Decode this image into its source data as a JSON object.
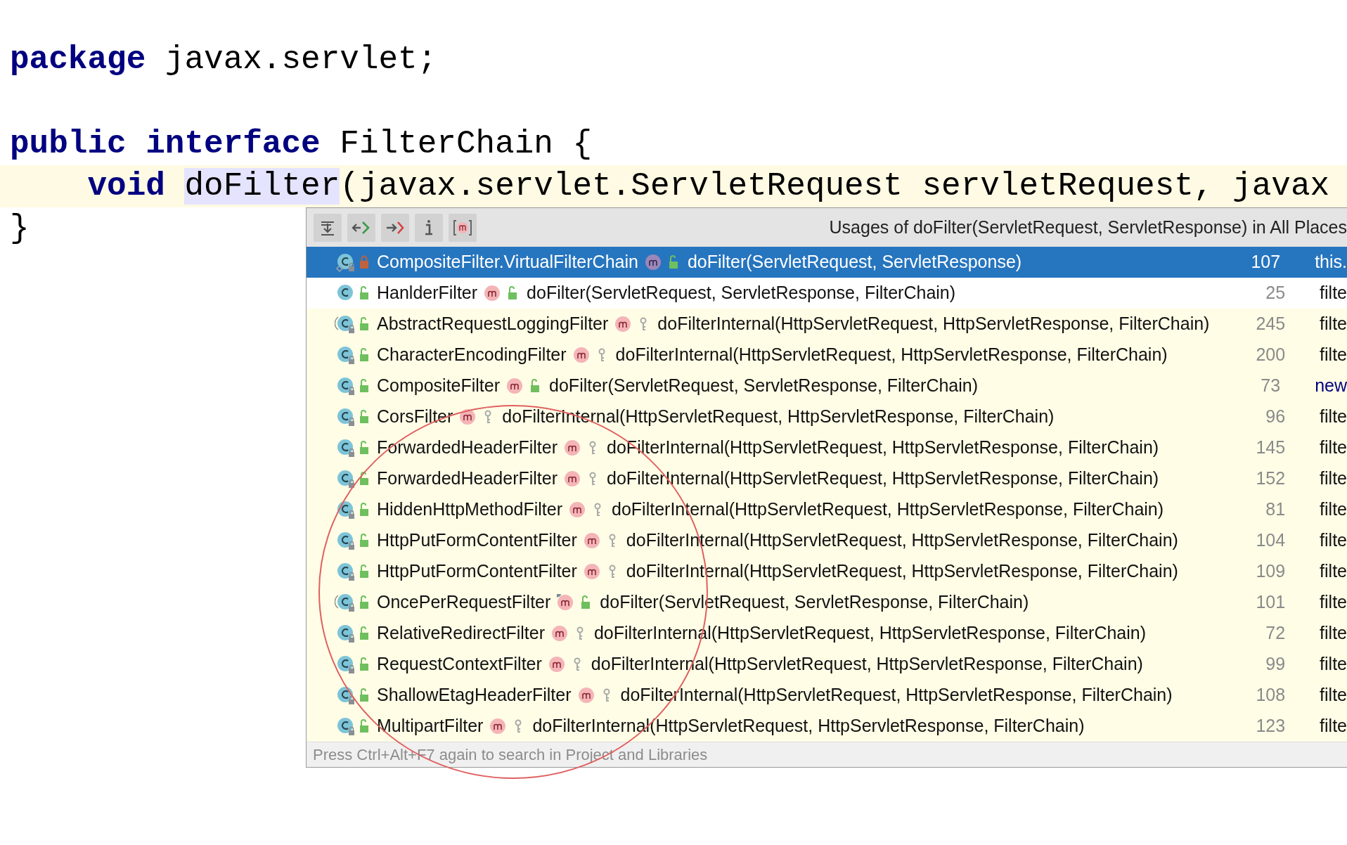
{
  "editor": {
    "blocks": [
      [
        {
          "current": false,
          "tokens": [
            {
              "kind": "keyword",
              "text": "package "
            },
            {
              "kind": "plain",
              "text": "javax.servlet;"
            }
          ]
        }
      ],
      [
        {
          "current": false,
          "tokens": [
            {
              "kind": "keyword",
              "text": "public interface "
            },
            {
              "kind": "plain",
              "text": "FilterChain {"
            }
          ]
        },
        {
          "current": true,
          "tokens": [
            {
              "kind": "keyword",
              "text": "    void "
            },
            {
              "kind": "usage",
              "text": "doFilter"
            },
            {
              "kind": "plain",
              "text": "(javax.servlet.ServletRequest servletRequest, javax"
            }
          ]
        },
        {
          "current": false,
          "tokens": [
            {
              "kind": "plain",
              "text": "}"
            }
          ]
        }
      ]
    ]
  },
  "usages_popup": {
    "toolbar": [
      {
        "kind": "merge"
      },
      {
        "kind": "previous"
      },
      {
        "kind": "next"
      },
      {
        "kind": "info"
      },
      {
        "kind": "methods"
      }
    ],
    "title": "Usages of doFilter(ServletRequest, ServletResponse) in All Places",
    "rows": [
      {
        "inner_class": true,
        "abstract": false,
        "library": true,
        "class_private": true,
        "class_name": "CompositeFilter.VirtualFilterChain",
        "overrides": false,
        "method_protected": false,
        "method": "doFilter(ServletRequest, ServletResponse)",
        "line": "107",
        "preview": "this.",
        "preview_keyword": false,
        "selected": true
      },
      {
        "inner_class": false,
        "abstract": false,
        "library": false,
        "class_private": false,
        "class_name": "HanlderFilter",
        "overrides": false,
        "method_protected": false,
        "method": "doFilter(ServletRequest, ServletResponse, FilterChain)",
        "line": "25",
        "preview": "filte",
        "preview_keyword": false,
        "selected": false
      },
      {
        "inner_class": false,
        "abstract": true,
        "library": true,
        "class_private": false,
        "class_name": "AbstractRequestLoggingFilter",
        "overrides": false,
        "method_protected": true,
        "method": "doFilterInternal(HttpServletRequest, HttpServletResponse, FilterChain)",
        "line": "245",
        "preview": "filte",
        "preview_keyword": false,
        "selected": false
      },
      {
        "inner_class": false,
        "abstract": false,
        "library": true,
        "class_private": false,
        "class_name": "CharacterEncodingFilter",
        "overrides": false,
        "method_protected": true,
        "method": "doFilterInternal(HttpServletRequest, HttpServletResponse, FilterChain)",
        "line": "200",
        "preview": "filte",
        "preview_keyword": false,
        "selected": false
      },
      {
        "inner_class": false,
        "abstract": false,
        "library": true,
        "class_private": false,
        "class_name": "CompositeFilter",
        "overrides": false,
        "method_protected": false,
        "method": "doFilter(ServletRequest, ServletResponse, FilterChain)",
        "line": "73",
        "preview": "new",
        "preview_keyword": true,
        "selected": false
      },
      {
        "inner_class": false,
        "abstract": false,
        "library": true,
        "class_private": false,
        "class_name": "CorsFilter",
        "overrides": false,
        "method_protected": true,
        "method": "doFilterInternal(HttpServletRequest, HttpServletResponse, FilterChain)",
        "line": "96",
        "preview": "filte",
        "preview_keyword": false,
        "selected": false
      },
      {
        "inner_class": false,
        "abstract": false,
        "library": true,
        "class_private": false,
        "class_name": "ForwardedHeaderFilter",
        "overrides": false,
        "method_protected": true,
        "method": "doFilterInternal(HttpServletRequest, HttpServletResponse, FilterChain)",
        "line": "145",
        "preview": "filte",
        "preview_keyword": false,
        "selected": false
      },
      {
        "inner_class": false,
        "abstract": false,
        "library": true,
        "class_private": false,
        "class_name": "ForwardedHeaderFilter",
        "overrides": false,
        "method_protected": true,
        "method": "doFilterInternal(HttpServletRequest, HttpServletResponse, FilterChain)",
        "line": "152",
        "preview": "filte",
        "preview_keyword": false,
        "selected": false
      },
      {
        "inner_class": false,
        "abstract": false,
        "library": true,
        "class_private": false,
        "class_name": "HiddenHttpMethodFilter",
        "overrides": false,
        "method_protected": true,
        "method": "doFilterInternal(HttpServletRequest, HttpServletResponse, FilterChain)",
        "line": "81",
        "preview": "filte",
        "preview_keyword": false,
        "selected": false
      },
      {
        "inner_class": false,
        "abstract": false,
        "library": true,
        "class_private": false,
        "class_name": "HttpPutFormContentFilter",
        "overrides": false,
        "method_protected": true,
        "method": "doFilterInternal(HttpServletRequest, HttpServletResponse, FilterChain)",
        "line": "104",
        "preview": "filte",
        "preview_keyword": false,
        "selected": false
      },
      {
        "inner_class": false,
        "abstract": false,
        "library": true,
        "class_private": false,
        "class_name": "HttpPutFormContentFilter",
        "overrides": false,
        "method_protected": true,
        "method": "doFilterInternal(HttpServletRequest, HttpServletResponse, FilterChain)",
        "line": "109",
        "preview": "filte",
        "preview_keyword": false,
        "selected": false
      },
      {
        "inner_class": false,
        "abstract": true,
        "library": true,
        "class_private": false,
        "class_name": "OncePerRequestFilter",
        "overrides": true,
        "method_protected": false,
        "method": "doFilter(ServletRequest, ServletResponse, FilterChain)",
        "line": "101",
        "preview": "filte",
        "preview_keyword": false,
        "selected": false
      },
      {
        "inner_class": false,
        "abstract": false,
        "library": true,
        "class_private": false,
        "class_name": "RelativeRedirectFilter",
        "overrides": false,
        "method_protected": true,
        "method": "doFilterInternal(HttpServletRequest, HttpServletResponse, FilterChain)",
        "line": "72",
        "preview": "filte",
        "preview_keyword": false,
        "selected": false
      },
      {
        "inner_class": false,
        "abstract": false,
        "library": true,
        "class_private": false,
        "class_name": "RequestContextFilter",
        "overrides": false,
        "method_protected": true,
        "method": "doFilterInternal(HttpServletRequest, HttpServletResponse, FilterChain)",
        "line": "99",
        "preview": "filte",
        "preview_keyword": false,
        "selected": false
      },
      {
        "inner_class": false,
        "abstract": false,
        "library": true,
        "class_private": false,
        "class_name": "ShallowEtagHeaderFilter",
        "overrides": false,
        "method_protected": true,
        "method": "doFilterInternal(HttpServletRequest, HttpServletResponse, FilterChain)",
        "line": "108",
        "preview": "filte",
        "preview_keyword": false,
        "selected": false
      },
      {
        "inner_class": false,
        "abstract": false,
        "library": true,
        "class_private": false,
        "class_name": "MultipartFilter",
        "overrides": false,
        "method_protected": true,
        "method": "doFilterInternal(HttpServletRequest, HttpServletResponse, FilterChain)",
        "line": "123",
        "preview": "filte",
        "preview_keyword": false,
        "selected": false
      }
    ],
    "status": "Press Ctrl+Alt+F7 again to search in Project and Libraries"
  }
}
